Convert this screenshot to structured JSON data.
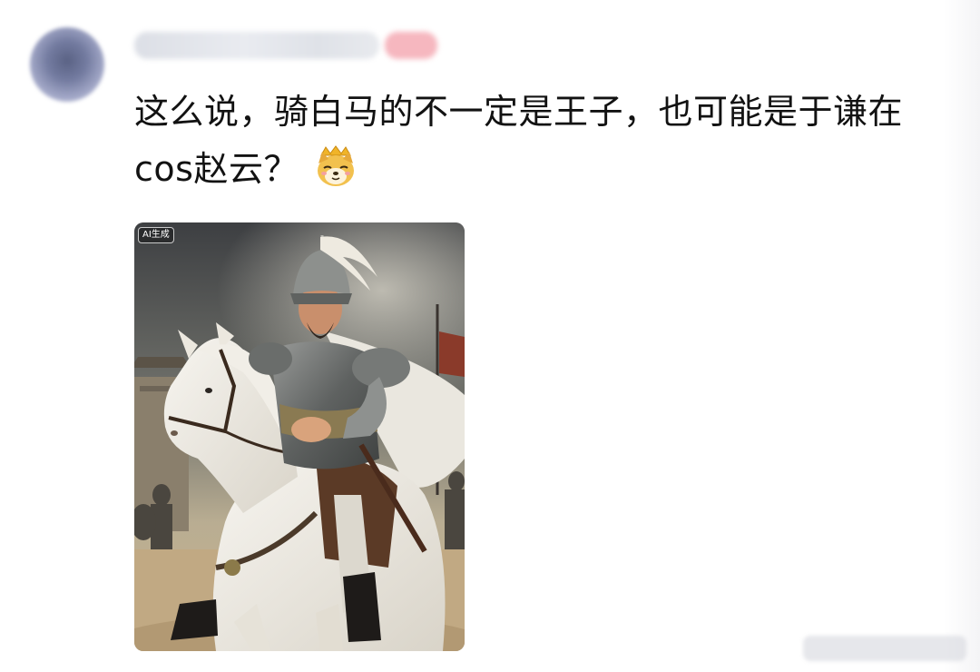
{
  "comment": {
    "line1": "这么说，骑白马的不一定是王子，也可能是于谦在",
    "line2": "cos赵云？"
  },
  "emoji": {
    "icon": "doge-emoji-icon"
  },
  "image": {
    "ai_label": "AI生成",
    "description_icon": "general-on-white-horse-image"
  },
  "colors": {
    "text": "#121212",
    "badge": "#f6b7bf"
  }
}
